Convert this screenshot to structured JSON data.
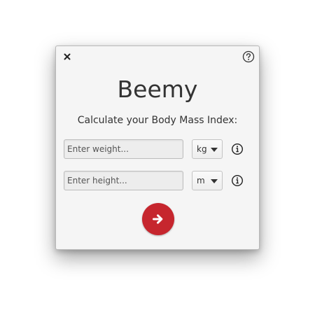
{
  "app": {
    "title": "Beemy",
    "subtitle": "Calculate your Body Mass Index:"
  },
  "weight": {
    "placeholder": "Enter weight...",
    "value": "",
    "unit": "kg"
  },
  "height": {
    "placeholder": "Enter height...",
    "value": "",
    "unit": "m"
  },
  "icons": {
    "close": "close-icon",
    "help": "help-icon",
    "info": "info-icon",
    "submit": "arrow-right-icon"
  },
  "colors": {
    "accent": "#c6262e",
    "window_bg": "#f5f5f5",
    "text": "#333333"
  }
}
